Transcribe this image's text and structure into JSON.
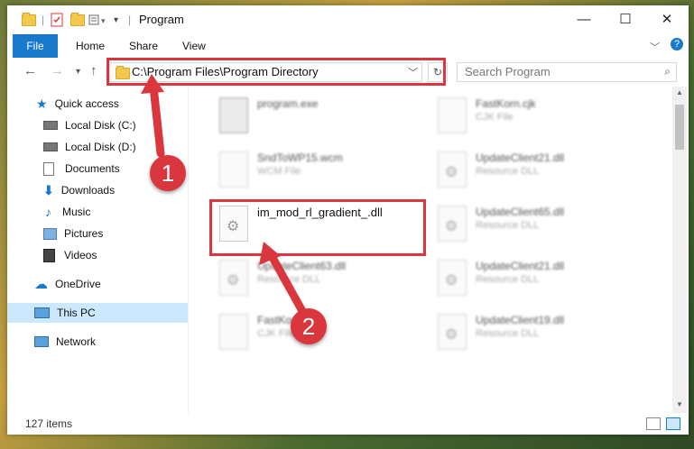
{
  "window": {
    "title": "Program"
  },
  "ribbon": {
    "tabs": [
      "File",
      "Home",
      "Share",
      "View"
    ]
  },
  "nav": {
    "address": "C:\\Program Files\\Program Directory",
    "search_placeholder": "Search Program"
  },
  "sidebar": {
    "items": [
      {
        "label": "Quick access",
        "icon": "star-icon"
      },
      {
        "label": "Local Disk (C:)",
        "icon": "drive-icon"
      },
      {
        "label": "Local Disk (D:)",
        "icon": "drive-icon"
      },
      {
        "label": "Documents",
        "icon": "documents-icon"
      },
      {
        "label": "Downloads",
        "icon": "download-icon"
      },
      {
        "label": "Music",
        "icon": "music-icon"
      },
      {
        "label": "Pictures",
        "icon": "pictures-icon"
      },
      {
        "label": "Videos",
        "icon": "videos-icon"
      },
      {
        "label": "OneDrive",
        "icon": "cloud-icon"
      },
      {
        "label": "This PC",
        "icon": "computer-icon"
      },
      {
        "label": "Network",
        "icon": "network-icon"
      }
    ]
  },
  "files": [
    {
      "name": "program.exe",
      "type": ""
    },
    {
      "name": "FastKorn.cjk",
      "type": "CJK File"
    },
    {
      "name": "SndToWP15.wcm",
      "type": "WCM File"
    },
    {
      "name": "UpdateClient21.dll",
      "type": "Resource DLL"
    },
    {
      "name": "im_mod_rl_gradient_.dll",
      "type": ""
    },
    {
      "name": "UpdateClient65.dll",
      "type": "Resource DLL"
    },
    {
      "name": "UpdateClient63.dll",
      "type": "Resource DLL"
    },
    {
      "name": "UpdateClient21.dll",
      "type": "Resource DLL"
    },
    {
      "name": "FastKorn.cjk",
      "type": "CJK File"
    },
    {
      "name": "UpdateClient19.dll",
      "type": "Resource DLL"
    }
  ],
  "status": {
    "items_count": "127 items"
  },
  "annotations": {
    "step1": "1",
    "step2": "2"
  },
  "colors": {
    "accent": "#1979ca",
    "highlight": "#d9363e",
    "selected": "#cce8ff"
  }
}
